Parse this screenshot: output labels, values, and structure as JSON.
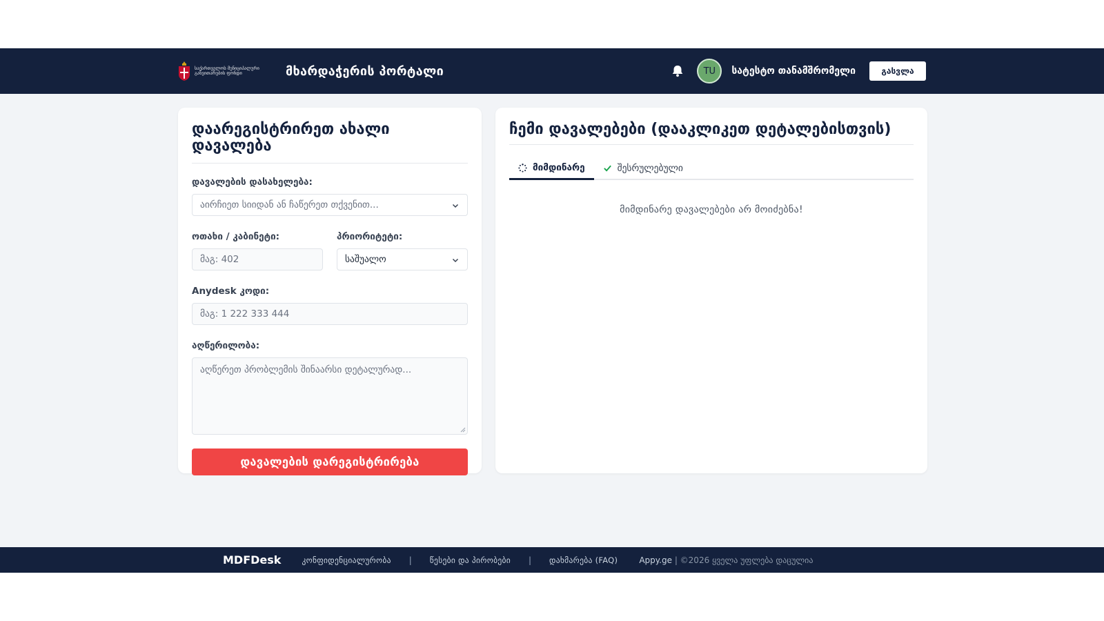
{
  "header": {
    "logo_text": "საქართველოს მუნიციპალური განვითარების ფონდი",
    "portal_title": "მხარდაჭერის პორტალი",
    "avatar_initials": "TU",
    "user_name": "სატესტო თანამშრომელი",
    "logout_label": "გასვლა"
  },
  "form": {
    "title": "დაარეგისტრირეთ ახალი დავალება",
    "task_name_label": "დავალების დასახელება:",
    "task_name_placeholder": "აირჩიეთ სიიდან ან ჩაწერეთ თქვენით...",
    "room_label": "ოთახი / კაბინეტი:",
    "room_placeholder": "მაგ: 402",
    "priority_label": "პრიორიტეტი:",
    "priority_value": "საშუალო",
    "anydesk_label": "Anydesk კოდი:",
    "anydesk_placeholder": "მაგ: 1 222 333 444",
    "description_label": "აღწერილობა:",
    "description_placeholder": "აღწერეთ პრობლემის შინაარსი დეტალურად...",
    "submit_label": "დავალების დარეგისტრირება"
  },
  "tasks": {
    "title": "ჩემი დავალებები (დააკლიკეთ დეტალებისთვის)",
    "tabs": [
      {
        "label": "მიმდინარე",
        "icon": "spinner-icon",
        "active": true
      },
      {
        "label": "შესრულებული",
        "icon": "check-icon",
        "active": false
      }
    ],
    "empty_message": "მიმდინარე დავალებები არ მოიძებნა!"
  },
  "footer": {
    "brand": "MDFDesk",
    "links": [
      "კონფიდენციალურობა",
      "წესები და პირობები",
      "დახმარება (FAQ)"
    ],
    "separator": "|",
    "company": "Appy.ge",
    "copyright": "| ©2026 ყველა უფლება დაცულია"
  },
  "colors": {
    "navy": "#14213d",
    "accent_red": "#f04545",
    "avatar_green": "#6aa86c",
    "success_green": "#16a34a"
  }
}
